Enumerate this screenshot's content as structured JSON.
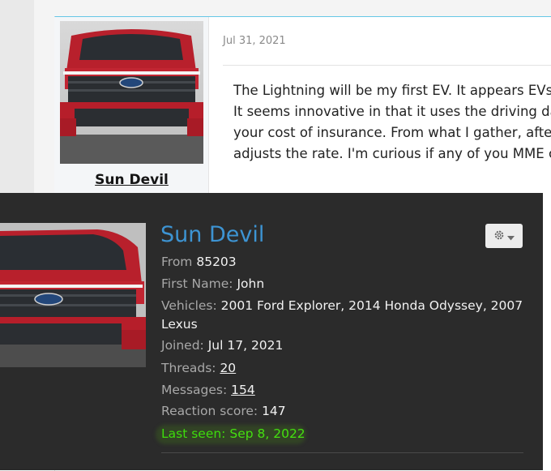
{
  "post": {
    "date": "Jul 31, 2021",
    "author": "Sun Devil",
    "body_lines": [
      "The Lightning will be my first EV. It appears EVs",
      "It seems innovative in that it uses the driving da",
      "your cost of insurance. From what I gather, after",
      "adjusts the rate. I'm curious if any of you MME c"
    ]
  },
  "tooltip": {
    "name": "Sun Devil",
    "from_label": "From",
    "from_value": "85203",
    "first_name_label": "First Name:",
    "first_name_value": "John",
    "vehicles_label": "Vehicles:",
    "vehicles_value_line1": "2001 Ford Explorer, 2014 Honda Odyssey, 2007",
    "vehicles_value_line2": "Lexus",
    "joined_label": "Joined:",
    "joined_value": "Jul 17, 2021",
    "threads_label": "Threads:",
    "threads_value": "20",
    "messages_label": "Messages:",
    "messages_value": "154",
    "reaction_label": "Reaction score:",
    "reaction_value": "147",
    "last_seen_label": "Last seen:",
    "last_seen_value": "Sep 8, 2022",
    "gear_icon": "gear-icon",
    "caret_icon": "caret-down-icon"
  },
  "colors": {
    "accent_link": "#3d94d3",
    "last_seen_green": "#3ddc0c",
    "tooltip_bg": "#2b2b2b",
    "card_border_top": "#66c7e6"
  }
}
